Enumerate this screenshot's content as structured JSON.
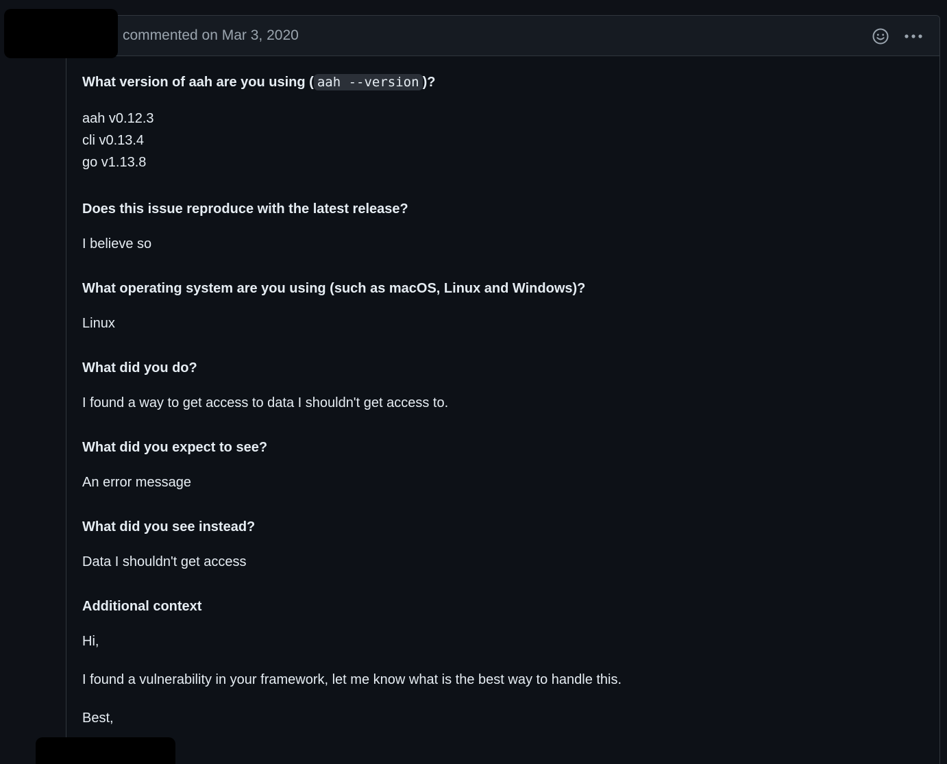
{
  "comment": {
    "header": {
      "meta": "commented on Mar 3, 2020",
      "reaction_icon": "smiley-icon",
      "menu_icon": "kebab-horizontal-icon"
    },
    "sections": [
      {
        "question_prefix": "What version of aah are you using (",
        "question_code": "aah --version",
        "question_suffix": ")?",
        "answer_lines": [
          "aah v0.12.3",
          "cli v0.13.4",
          "go v1.13.8"
        ]
      },
      {
        "question": "Does this issue reproduce with the latest release?",
        "answer": "I believe so"
      },
      {
        "question": "What operating system are you using (such as macOS, Linux and Windows)?",
        "answer": "Linux"
      },
      {
        "question": "What did you do?",
        "answer": "I found a way to get access to data I shouldn't get access to."
      },
      {
        "question": "What did you expect to see?",
        "answer": "An error message"
      },
      {
        "question": "What did you see instead?",
        "answer": "Data I shouldn't get access"
      },
      {
        "question": "Additional context",
        "paragraphs": [
          "Hi,",
          "I found a vulnerability in your framework, let me know what is the best way to handle this.",
          "Best,"
        ]
      }
    ]
  },
  "colors": {
    "background": "#0e1117",
    "header_bg": "#161b22",
    "border": "#30363d",
    "text": "#e6edf3",
    "muted": "#9aa4ae",
    "code_bg": "#2b3038"
  }
}
